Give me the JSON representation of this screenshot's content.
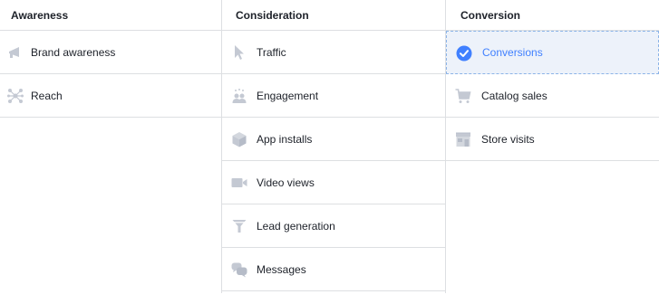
{
  "colors": {
    "icon_gray": "#c4c9d3",
    "accent": "#4080ff",
    "selected_bg": "#edf2fa",
    "border": "#dddfe2"
  },
  "columns": {
    "awareness": {
      "header": "Awareness",
      "items": [
        {
          "label": "Brand awareness",
          "icon": "megaphone-icon"
        },
        {
          "label": "Reach",
          "icon": "reach-icon"
        }
      ]
    },
    "consideration": {
      "header": "Consideration",
      "items": [
        {
          "label": "Traffic",
          "icon": "cursor-icon"
        },
        {
          "label": "Engagement",
          "icon": "people-icon"
        },
        {
          "label": "App installs",
          "icon": "box-icon"
        },
        {
          "label": "Video views",
          "icon": "video-camera-icon"
        },
        {
          "label": "Lead generation",
          "icon": "funnel-icon"
        },
        {
          "label": "Messages",
          "icon": "chat-bubbles-icon"
        }
      ]
    },
    "conversion": {
      "header": "Conversion",
      "items": [
        {
          "label": "Conversions",
          "icon": "check-circle-icon",
          "selected": true
        },
        {
          "label": "Catalog sales",
          "icon": "shopping-cart-icon"
        },
        {
          "label": "Store visits",
          "icon": "storefront-icon"
        }
      ]
    }
  }
}
